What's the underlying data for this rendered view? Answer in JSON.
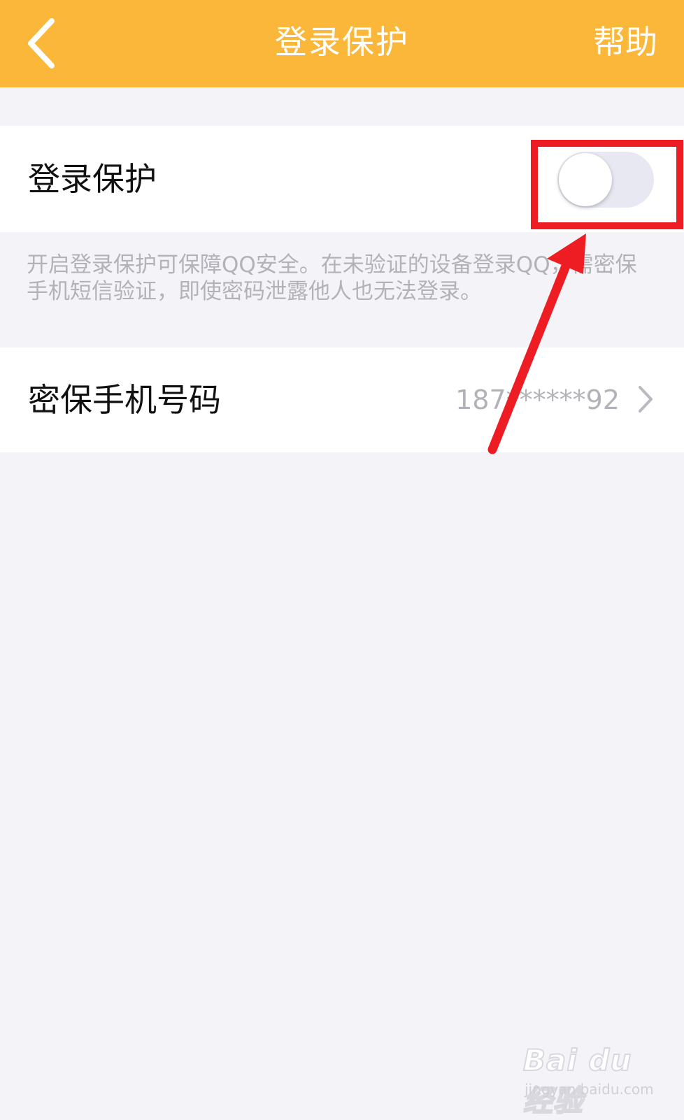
{
  "colors": {
    "header_background": "#fbb73a",
    "page_background": "#f4f4f8",
    "annotation_red": "#ee1d24"
  },
  "header": {
    "back_icon": "chevron-left-icon",
    "title": "登录保护",
    "help_label": "帮助"
  },
  "login_protection": {
    "label": "登录保护",
    "toggle_state": "off",
    "description": "开启登录保护可保障QQ安全。在未验证的设备登录QQ，需密保手机短信验证，即使密码泄露他人也无法登录。"
  },
  "secure_phone": {
    "label": "密保手机号码",
    "value": "187******92",
    "chevron_icon": "chevron-right-icon"
  },
  "annotation": {
    "highlight": "red-box-around-toggle",
    "arrow": "red-arrow-pointing-to-toggle"
  },
  "watermark": {
    "text": "Bai du 经验",
    "url": "jingyan.baidu.com"
  }
}
